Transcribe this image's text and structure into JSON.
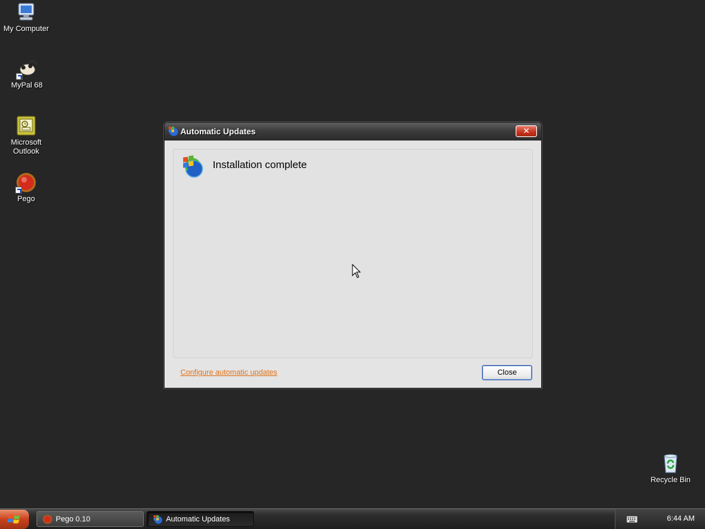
{
  "desktop": {
    "icons": [
      {
        "label": "My Computer"
      },
      {
        "label": "MyPal 68"
      },
      {
        "label": "Microsoft Outlook"
      },
      {
        "label": "Pego"
      },
      {
        "label": "Recycle Bin"
      }
    ]
  },
  "dialog": {
    "title": "Automatic Updates",
    "close_glyph": "✕",
    "heading": "Installation complete",
    "configure_link": "Configure automatic updates",
    "close_button": "Close"
  },
  "taskbar": {
    "tasks": [
      {
        "label": "Pego 0.10",
        "icon": "pego-icon",
        "active": false
      },
      {
        "label": "Automatic Updates",
        "icon": "windows-update-icon",
        "active": true
      }
    ],
    "clock": "6:44 AM"
  },
  "colors": {
    "desktop_background": "#262626",
    "link": "#e0731b",
    "close_button_red": "#c4321b",
    "start_button": "#c9421c"
  }
}
